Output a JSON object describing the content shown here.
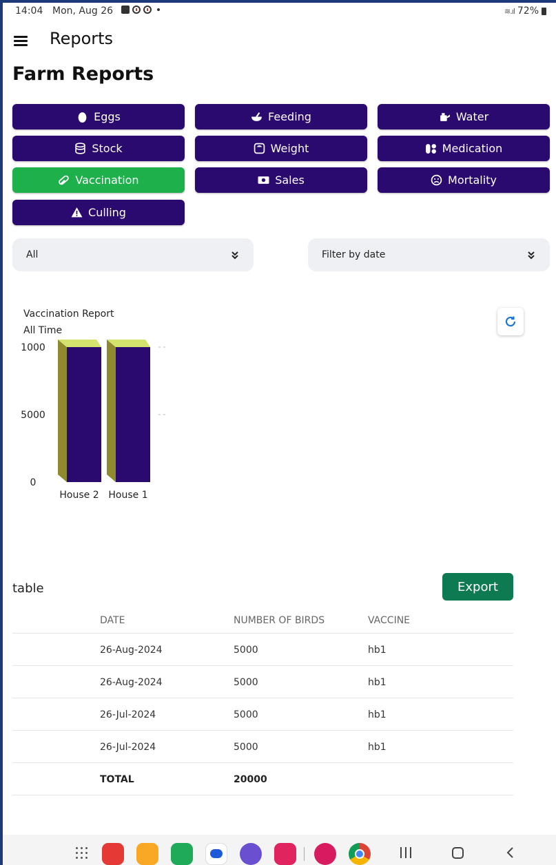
{
  "status_bar": {
    "time": "14:04",
    "date": "Mon, Aug 26",
    "battery": "72%"
  },
  "app_bar": {
    "title": "Reports"
  },
  "page_title": "Farm Reports",
  "report_buttons": [
    {
      "label": "Eggs",
      "icon": "egg-icon"
    },
    {
      "label": "Feeding",
      "icon": "feeding-bowl-icon"
    },
    {
      "label": "Water",
      "icon": "water-can-icon"
    },
    {
      "label": "Stock",
      "icon": "database-icon"
    },
    {
      "label": "Weight",
      "icon": "scale-icon"
    },
    {
      "label": "Medication",
      "icon": "pills-icon"
    },
    {
      "label": "Vaccination",
      "icon": "capsule-icon",
      "active": true
    },
    {
      "label": "Sales",
      "icon": "money-icon"
    },
    {
      "label": "Mortality",
      "icon": "sad-face-icon"
    },
    {
      "label": "Culling",
      "icon": "warning-icon"
    }
  ],
  "filters": {
    "house": "All",
    "date": "Filter by date"
  },
  "colors": {
    "button_bg": "#2a0a6e",
    "active_bg": "#1db04b",
    "bar_front": "#2a0a6e",
    "bar_side": "#8f8a2e",
    "bar_top": "#d4e36e",
    "export_bg": "#0e7a51"
  },
  "chart_data": {
    "type": "bar",
    "title": "Vaccination Report",
    "subtitle": "All Time",
    "categories": [
      "House 2",
      "House 1"
    ],
    "values": [
      10000,
      10000
    ],
    "y_tick_labels": [
      "0",
      "5000",
      "1000"
    ],
    "ylim": [
      0,
      10000
    ]
  },
  "table": {
    "title": "table",
    "export_label": "Export",
    "columns": [
      "DATE",
      "NUMBER OF BIRDS",
      "VACCINE"
    ],
    "rows": [
      [
        "26-Aug-2024",
        "5000",
        "hb1"
      ],
      [
        "26-Aug-2024",
        "5000",
        "hb1"
      ],
      [
        "26-Jul-2024",
        "5000",
        "hb1"
      ],
      [
        "26-Jul-2024",
        "5000",
        "hb1"
      ]
    ],
    "total_label": "TOTAL",
    "total_value": "20000"
  },
  "nav_bar": {
    "apps": [
      "app-grid-icon",
      "notes-app-icon",
      "files-app-icon",
      "phone-app-icon",
      "messages-app-icon",
      "internet-app-icon",
      "camera-app-icon",
      "gallery-app-icon",
      "chrome-app-icon"
    ]
  }
}
